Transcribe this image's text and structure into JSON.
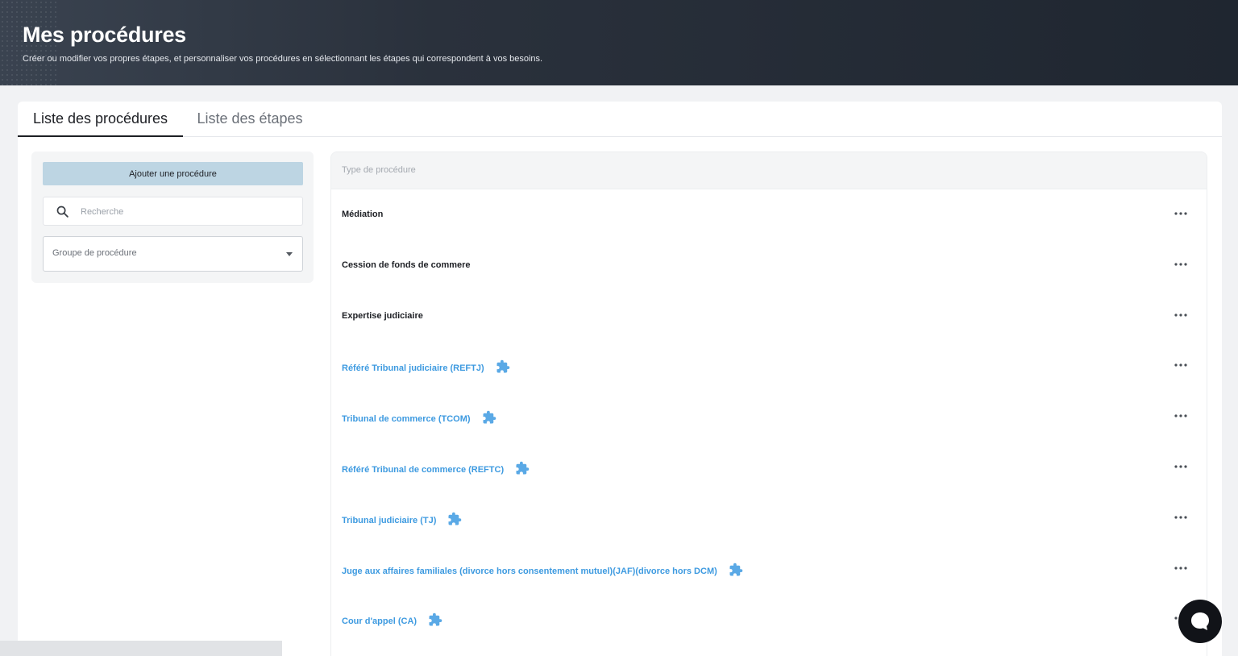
{
  "header": {
    "title": "Mes procédures",
    "subtitle": "Créer ou modifier vos propres étapes, et personnaliser vos procédures en sélectionnant les étapes qui correspondent à vos besoins."
  },
  "tabs": [
    {
      "label": "Liste des procédures",
      "active": true
    },
    {
      "label": "Liste des étapes",
      "active": false
    }
  ],
  "sidebar": {
    "add_button_label": "Ajouter une procédure",
    "search_placeholder": "Recherche",
    "group_select_label": "Groupe de procédure"
  },
  "table": {
    "column_header": "Type de procédure",
    "rows": [
      {
        "name": "Médiation",
        "standard": false
      },
      {
        "name": "Cession de fonds de commere",
        "standard": false
      },
      {
        "name": "Expertise judiciaire",
        "standard": false
      },
      {
        "name": "Référé Tribunal judiciaire (REFTJ)",
        "standard": true
      },
      {
        "name": "Tribunal de commerce (TCOM)",
        "standard": true
      },
      {
        "name": "Référé Tribunal de commerce (REFTC)",
        "standard": true
      },
      {
        "name": "Tribunal judiciaire (TJ)",
        "standard": true
      },
      {
        "name": "Juge aux affaires familiales (divorce hors consentement mutuel)(JAF)(divorce hors DCM)",
        "standard": true
      },
      {
        "name": "Cour d'appel (CA)",
        "standard": true
      }
    ]
  },
  "icons": {
    "search": "search-icon",
    "dropdown": "chevron-down-icon",
    "standard_procedure": "puzzle-icon",
    "row_menu": "more-horizontal-icon",
    "chat": "chat-bubble-icon"
  },
  "colors": {
    "header_bg": "#2a313c",
    "primary_button_bg": "#bdd5e3",
    "link_blue": "#3d9ae0",
    "chat_bg": "#111318"
  }
}
